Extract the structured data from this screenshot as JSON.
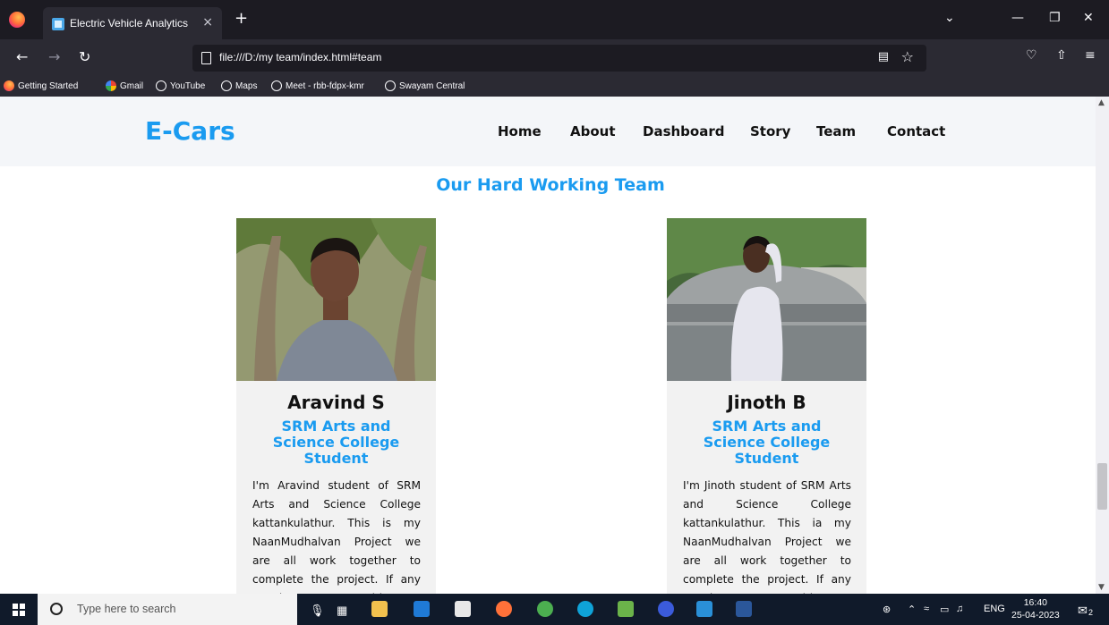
{
  "browser": {
    "tab_title": "Electric Vehicle Analytics",
    "tab_close": "×",
    "new_tab": "+",
    "url": "file:///D:/my team/index.html#team",
    "bookmarks": [
      "Getting Started",
      "Gmail",
      "YouTube",
      "Maps",
      "Meet - rbb-fdpx-kmr",
      "Swayam Central"
    ]
  },
  "site": {
    "brand": "E-Cars",
    "menu": [
      "Home",
      "About",
      "Dashboard",
      "Story",
      "Team",
      "Contact"
    ],
    "section_title": "Our Hard Working Team",
    "members": [
      {
        "name": "Aravind S",
        "role": "SRM Arts and Science College Student",
        "bio": "I'm Aravind student of SRM Arts and Science College kattankulathur. This is my NaanMudhalvan Project we are all work together to complete the project. If any Queries contact me with"
      },
      {
        "name": "Jinoth B",
        "role": "SRM Arts and Science College Student",
        "bio": "I'm Jinoth student of SRM Arts and Science College kattankulathur. This ia my NaanMudhalvan Project we are all work together to complete the project. If any Queries contact me with"
      }
    ]
  },
  "taskbar": {
    "search_placeholder": "Type here to search",
    "language": "ENG",
    "time": "16:40",
    "date": "25-04-2023",
    "notification_count": "2"
  },
  "colors": {
    "accent": "#1a9bf0",
    "card_bg": "#f2f2f2",
    "chrome_dark": "#1c1b22",
    "chrome": "#2b2a33",
    "taskbar": "#101a2a"
  }
}
